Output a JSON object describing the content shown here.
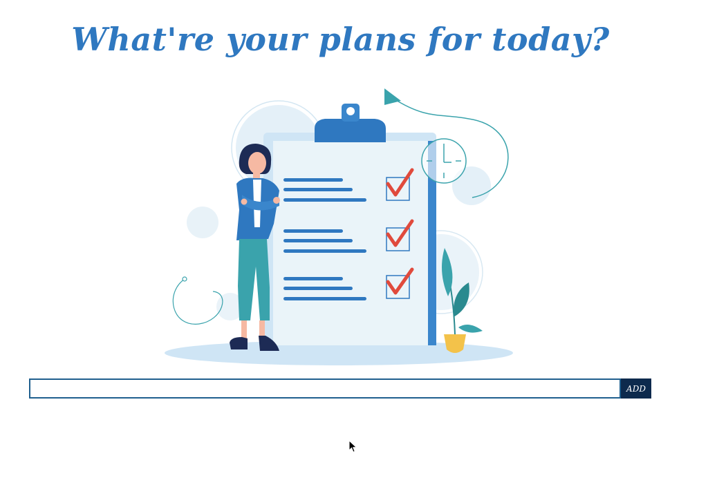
{
  "header": {
    "title": "What're your plans for today?"
  },
  "illustration": {
    "name": "woman-with-checklist-clipboard",
    "colors": {
      "primary_blue": "#2f78c0",
      "light_blue": "#cfe5f5",
      "teal": "#3aa3ac",
      "check_red": "#e04a3c",
      "pot_yellow": "#f3c24a",
      "navy": "#1d2b55"
    }
  },
  "todo": {
    "input_value": "",
    "input_placeholder": "",
    "add_label": "ADD"
  },
  "colors": {
    "title": "#2f78c0",
    "input_border": "#1f5f8e",
    "button_bg": "#0d2a4d",
    "button_text": "#ffffff"
  }
}
